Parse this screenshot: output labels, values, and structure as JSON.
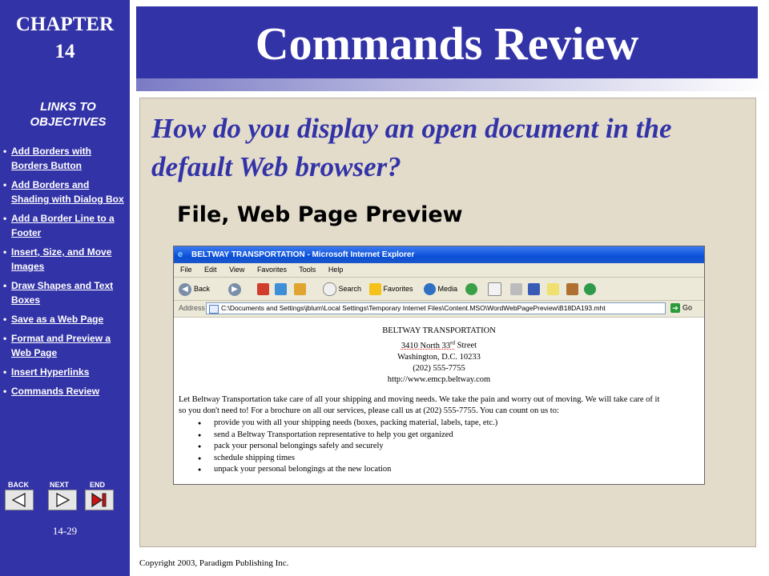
{
  "sidebar": {
    "chapter_label": "CHAPTER",
    "chapter_number": "14",
    "links_title": "LINKS TO OBJECTIVES",
    "links": [
      "Add Borders with Borders Button",
      "Add Borders and Shading with Dialog Box",
      "Add a Border Line to a Footer",
      "Insert, Size, and Move Images",
      "Draw Shapes and Text Boxes",
      "Save as a Web Page",
      "Format and Preview a Web Page",
      "Insert Hyperlinks",
      "Commands Review"
    ],
    "nav": {
      "back": "BACK",
      "next": "NEXT",
      "end": "END"
    },
    "page_number": "14-29"
  },
  "header": {
    "title": "Commands Review"
  },
  "content": {
    "question": "How do you display an open document in the default Web browser?",
    "answer": "File, Web Page Preview"
  },
  "browser": {
    "window_title": "BELTWAY TRANSPORTATION - Microsoft Internet Explorer",
    "menu": [
      "File",
      "Edit",
      "View",
      "Favorites",
      "Tools",
      "Help"
    ],
    "toolbar": {
      "back": "Back",
      "search": "Search",
      "favorites": "Favorites",
      "media": "Media"
    },
    "address_label": "Address",
    "address_value": "C:\\Documents and Settings\\jblum\\Local Settings\\Temporary Internet Files\\Content.MSO\\WordWebPagePreview\\B18DA193.mht",
    "go_label": "Go",
    "document": {
      "company": "BELTWAY TRANSPORTATION",
      "street_number": "3410 North 33",
      "street_suffix": "rd",
      "street_name": " Street",
      "city": "Washington, D.C. 10233",
      "phone": "(202) 555-7755",
      "website": "http://www.emcp.beltway.com",
      "paragraph_line1": "Let Beltway Transportation take care of all your shipping and moving needs. We take the pain and worry out of moving. We will take care of it",
      "paragraph_line2": "so you don't need to! For a brochure on all our services, please call us at (202) 555-7755. You can count on us to:",
      "bullets": [
        "provide you with all your shipping needs (boxes, packing material, labels, tape, etc.)",
        "send a Beltway Transportation representative to help you get organized",
        "pack your personal belongings safely and securely",
        "schedule shipping times",
        "unpack your personal belongings at the new location"
      ]
    }
  },
  "footer": {
    "copyright": "Copyright 2003, Paradigm Publishing Inc."
  },
  "colors": {
    "sidebar_blue": "#3333a8",
    "content_bg": "#e3dccb",
    "question_blue": "#3333a8"
  }
}
